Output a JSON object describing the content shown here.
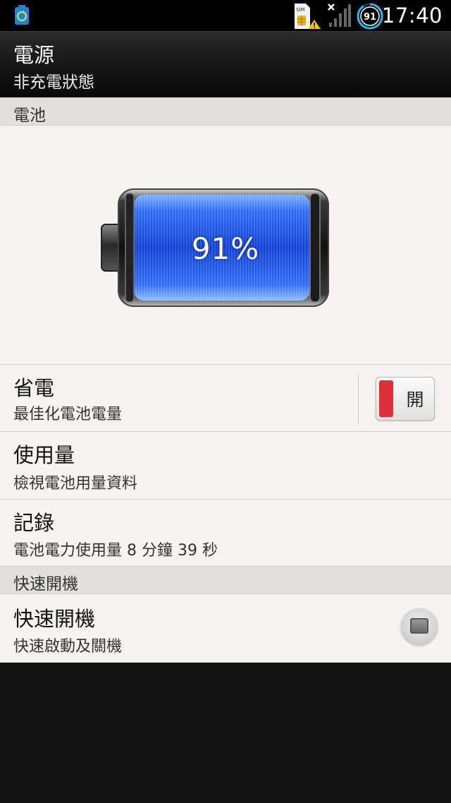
{
  "status_bar": {
    "time": "17:40",
    "battery_badge": "91",
    "sim_label": "SIM"
  },
  "title_bar": {
    "title": "電源",
    "subtitle": "非充電狀態"
  },
  "battery_section": {
    "header": "電池",
    "percent_text": "91%",
    "level": 0.91,
    "accent_color": "#1f5ef0"
  },
  "settings": {
    "power_saver": {
      "title": "省電",
      "summary": "最佳化電池電量",
      "toggle_label": "開",
      "toggle_color": "#e02e3a"
    },
    "usage": {
      "title": "使用量",
      "summary": "檢視電池用量資料"
    },
    "history": {
      "title": "記錄",
      "summary": "電池電力使用量 8 分鐘 39 秒"
    }
  },
  "fast_boot_section": {
    "header": "快速開機",
    "item": {
      "title": "快速開機",
      "summary": "快速啟動及關機",
      "checked": false
    }
  }
}
